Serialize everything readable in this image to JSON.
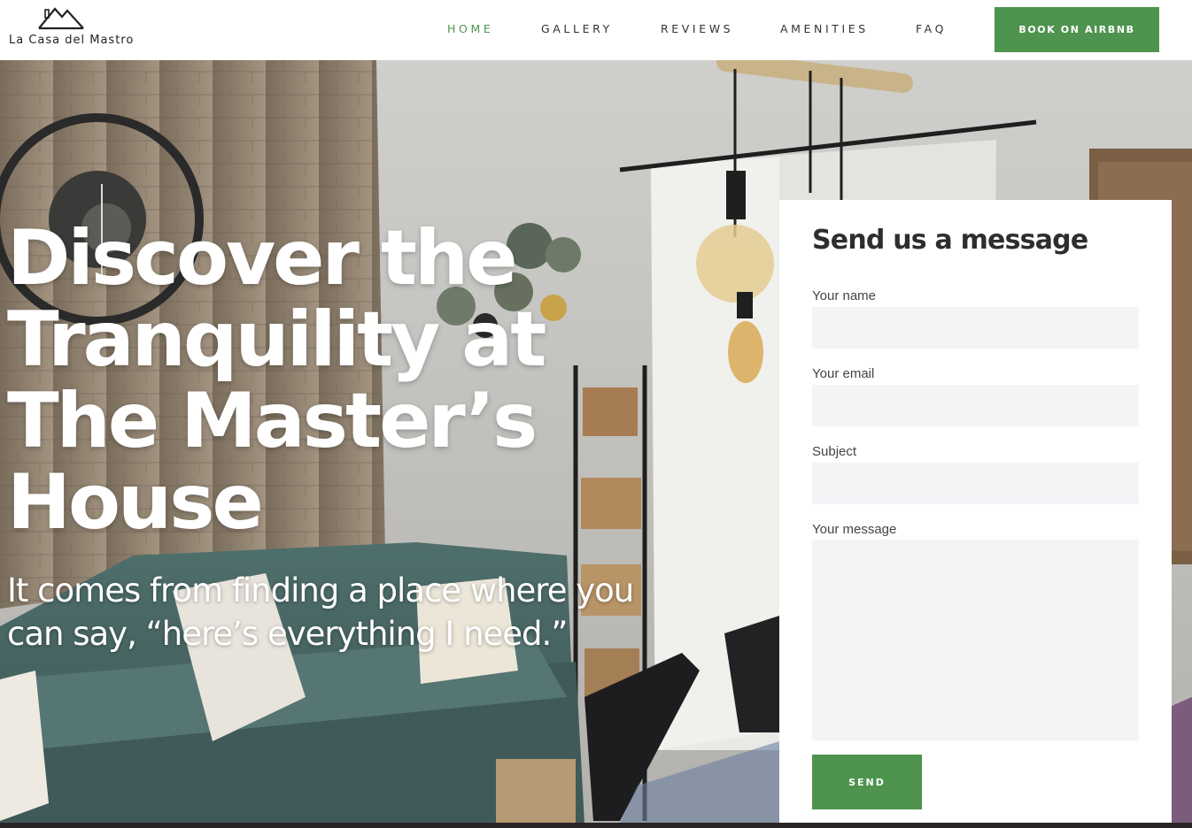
{
  "brand": {
    "logo_text": "La Casa del Mastro",
    "accent_color": "#4e944f"
  },
  "nav": {
    "items": [
      {
        "label": "HOME",
        "active": true
      },
      {
        "label": "GALLERY",
        "active": false
      },
      {
        "label": "REVIEWS",
        "active": false
      },
      {
        "label": "AMENITIES",
        "active": false
      },
      {
        "label": "FAQ",
        "active": false
      }
    ],
    "cta_label": "BOOK ON AIRBNB"
  },
  "hero": {
    "title": "Discover the Tranquility at The Master’s House",
    "subtitle": "It comes from finding a place where you can say, “here’s everything I need.”"
  },
  "contact_form": {
    "title": "Send us a message",
    "fields": [
      {
        "label": "Your name",
        "value": ""
      },
      {
        "label": "Your email",
        "value": ""
      },
      {
        "label": "Subject",
        "value": ""
      },
      {
        "label": "Your message",
        "value": ""
      }
    ],
    "submit_label": "SEND"
  }
}
